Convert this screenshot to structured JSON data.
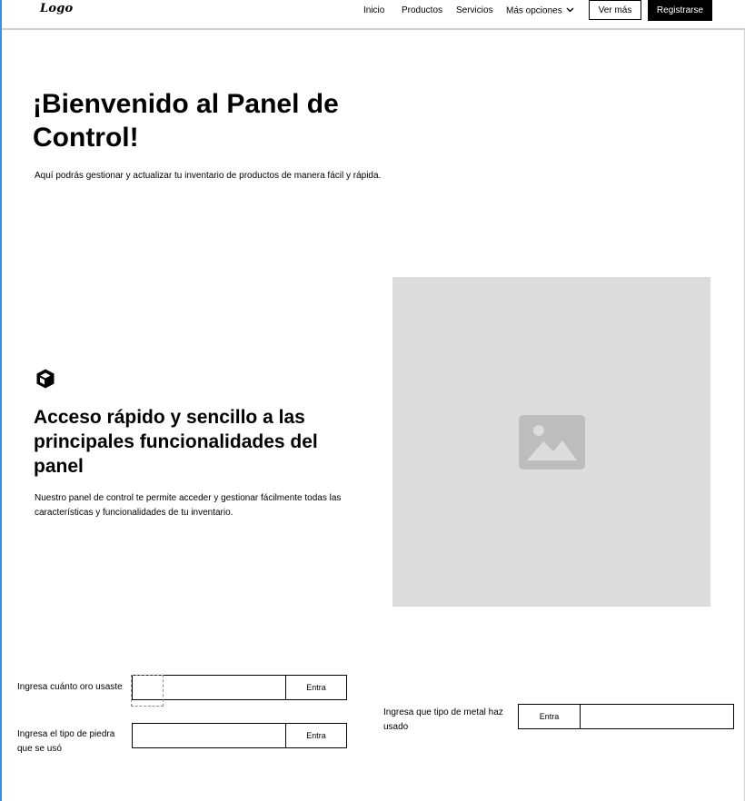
{
  "navbar": {
    "logo": "Logo",
    "links": [
      "Inicio",
      "Productos",
      "Servicios"
    ],
    "more_label": "Más opciones",
    "more_icon": "chevron-down-icon",
    "secondary_button": "Ver más",
    "primary_button": "Registrarse"
  },
  "hero": {
    "title": "¡Bienvenido al Panel de Control!",
    "subtitle": "Aquí podrás gestionar y actualizar tu inventario de productos de manera fácil y rápida."
  },
  "feature": {
    "icon": "cube-icon",
    "title": "Acceso rápido y sencillo a las principales funcionalidades del panel",
    "text": "Nuestro panel de control te permite acceder y gestionar fácilmente todas las características y funcionalidades de tu inventario.",
    "image_icon": "image-placeholder-icon"
  },
  "forms": {
    "gold": {
      "label": "Ingresa cuánto oro usaste",
      "value": "",
      "button": "Entra"
    },
    "stone": {
      "label": "Ingresa el tipo de piedra que se usó",
      "value": "",
      "button": "Entra"
    },
    "metal": {
      "label": "Ingresa que tipo de metal haz usado",
      "value": "",
      "button": "Entra"
    }
  },
  "colors": {
    "accent_rule": "#3b8fe0",
    "placeholder_bg": "#dcdcdc",
    "placeholder_icon": "#bdbdbd",
    "primary_button_bg": "#000000"
  }
}
